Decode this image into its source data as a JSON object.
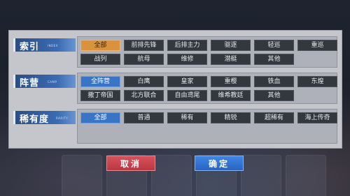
{
  "filters": {
    "index": {
      "title": "索引",
      "subtitle": "INDEX",
      "options": [
        "全部",
        "前排先锋",
        "后排主力",
        "驱逐",
        "轻巡",
        "重巡",
        "战列",
        "航母",
        "维修",
        "潜艇",
        "其他"
      ],
      "selected": "全部"
    },
    "camp": {
      "title": "阵营",
      "subtitle": "CAMP",
      "options": [
        "全阵营",
        "白鹰",
        "皇家",
        "重樱",
        "铁血",
        "东煌",
        "撒丁帝国",
        "北方联合",
        "自由鸢尾",
        "维希教廷",
        "其他"
      ],
      "selected": "全阵营"
    },
    "rarity": {
      "title": "稀有度",
      "subtitle": "RARITY",
      "options": [
        "全部",
        "普通",
        "稀有",
        "精锐",
        "超稀有",
        "海上传奇"
      ],
      "selected": "全部"
    }
  },
  "buttons": {
    "cancel": "取消",
    "confirm": "确定"
  },
  "colors": {
    "selected_index": "#d9923d",
    "selected_other": "#3a74c4",
    "option_bg": "#33383f",
    "cancel": "#c9444d",
    "confirm": "#3576d4"
  }
}
